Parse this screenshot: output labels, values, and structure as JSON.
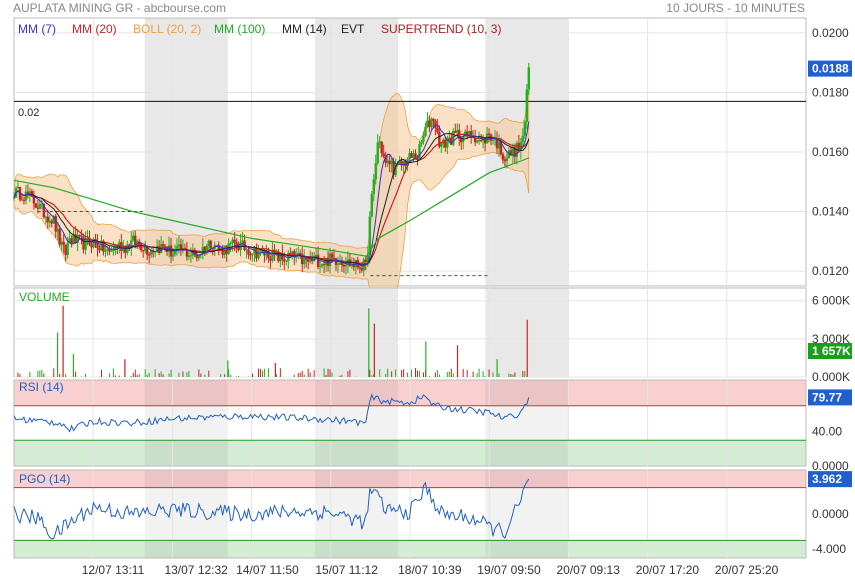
{
  "header": {
    "title": "AUPLATA MINING GR - abcbourse.com",
    "period": "10 JOURS - 10 MINUTES"
  },
  "colors": {
    "price_up": "#22b022",
    "price_down": "#cc2222",
    "mm7": "#3333cc",
    "mm20": "#cc2222",
    "boll": "#f0a040",
    "mm100": "#22aa22",
    "mm14": "#222222",
    "supertrend": "#aa2222",
    "last_badge": "#1f5fd0",
    "volume_badge": "#18a018",
    "rsi_line": "#2060c0",
    "pgo_line": "#2060c0",
    "overbought_zone": "#f8d0d0",
    "oversold_zone": "#d4ebd4",
    "session_shade": "#e8e8e8"
  },
  "chart_data": [
    {
      "type": "candlestick",
      "panel": "price",
      "legend": [
        {
          "label": "MM (7)",
          "color": "#3333cc"
        },
        {
          "label": "MM (20)",
          "color": "#cc2222"
        },
        {
          "label": "BOLL (20, 2)",
          "color": "#f0a040"
        },
        {
          "label": "MM (100)",
          "color": "#22aa22"
        },
        {
          "label": "MM (14)",
          "color": "#222222"
        },
        {
          "label": "EVT",
          "color": "#222222"
        },
        {
          "label": "SUPERTREND (10, 3)",
          "color": "#aa2222"
        }
      ],
      "yticks": [
        "0.0200",
        "0.0180",
        "0.0160",
        "0.0140",
        "0.0120"
      ],
      "ylim": [
        0.0115,
        0.0205
      ],
      "reference_line": {
        "label": "0.02",
        "value": 0.0177
      },
      "last_value": "0.0188",
      "xticks": [
        "12/07 13:11",
        "13/07 12:32",
        "14/07 11:50",
        "15/07 11:12",
        "18/07 10:39",
        "19/07 09:50",
        "20/07 09:13",
        "20/07 17:20",
        "20/07 25:20"
      ],
      "sessions": [
        "12/07",
        "13/07",
        "14/07",
        "15/07",
        "18/07",
        "19/07",
        "20/07"
      ],
      "close_path": [
        [
          0,
          0.01465
        ],
        [
          0.01,
          0.0146
        ],
        [
          0.02,
          0.0145
        ],
        [
          0.03,
          0.0142
        ],
        [
          0.04,
          0.0139
        ],
        [
          0.05,
          0.0137
        ],
        [
          0.06,
          0.0128
        ],
        [
          0.065,
          0.0126
        ],
        [
          0.07,
          0.0131
        ],
        [
          0.08,
          0.013
        ],
        [
          0.09,
          0.0129
        ],
        [
          0.1,
          0.013
        ],
        [
          0.11,
          0.0128
        ],
        [
          0.12,
          0.0126
        ],
        [
          0.13,
          0.0129
        ],
        [
          0.14,
          0.0128
        ],
        [
          0.15,
          0.013
        ],
        [
          0.16,
          0.0129
        ],
        [
          0.17,
          0.0127
        ],
        [
          0.18,
          0.0128
        ],
        [
          0.19,
          0.0128
        ],
        [
          0.2,
          0.0126
        ],
        [
          0.21,
          0.0127
        ],
        [
          0.22,
          0.0126
        ],
        [
          0.23,
          0.0125
        ],
        [
          0.24,
          0.0128
        ],
        [
          0.25,
          0.013
        ],
        [
          0.26,
          0.0127
        ],
        [
          0.27,
          0.0128
        ],
        [
          0.28,
          0.0129
        ],
        [
          0.29,
          0.0128
        ],
        [
          0.3,
          0.0127
        ],
        [
          0.31,
          0.0126
        ],
        [
          0.32,
          0.0126
        ],
        [
          0.33,
          0.0125
        ],
        [
          0.34,
          0.0124
        ],
        [
          0.35,
          0.0125
        ],
        [
          0.36,
          0.0124
        ],
        [
          0.37,
          0.0123
        ],
        [
          0.38,
          0.0124
        ],
        [
          0.39,
          0.0123
        ],
        [
          0.4,
          0.0124
        ],
        [
          0.41,
          0.0124
        ],
        [
          0.42,
          0.0123
        ],
        [
          0.43,
          0.0122
        ],
        [
          0.44,
          0.0122
        ],
        [
          0.445,
          0.0121
        ],
        [
          0.45,
          0.014
        ],
        [
          0.455,
          0.0152
        ],
        [
          0.46,
          0.0165
        ],
        [
          0.465,
          0.016
        ],
        [
          0.47,
          0.0155
        ],
        [
          0.475,
          0.0157
        ],
        [
          0.48,
          0.0154
        ],
        [
          0.49,
          0.0156
        ],
        [
          0.5,
          0.0158
        ],
        [
          0.51,
          0.0159
        ],
        [
          0.52,
          0.0168
        ],
        [
          0.53,
          0.0172
        ],
        [
          0.535,
          0.0165
        ],
        [
          0.54,
          0.0162
        ],
        [
          0.55,
          0.0164
        ],
        [
          0.56,
          0.0166
        ],
        [
          0.57,
          0.0165
        ],
        [
          0.58,
          0.0166
        ],
        [
          0.59,
          0.0163
        ],
        [
          0.6,
          0.0166
        ],
        [
          0.61,
          0.0163
        ],
        [
          0.62,
          0.0158
        ],
        [
          0.63,
          0.016
        ],
        [
          0.64,
          0.0162
        ],
        [
          0.645,
          0.017
        ],
        [
          0.65,
          0.0188
        ]
      ],
      "ema100_path": [
        [
          0,
          0.01505
        ],
        [
          0.05,
          0.0148
        ],
        [
          0.1,
          0.0144
        ],
        [
          0.15,
          0.014
        ],
        [
          0.2,
          0.0137
        ],
        [
          0.25,
          0.0134
        ],
        [
          0.3,
          0.0131
        ],
        [
          0.35,
          0.0129
        ],
        [
          0.4,
          0.0127
        ],
        [
          0.445,
          0.0125
        ],
        [
          0.46,
          0.0131
        ],
        [
          0.5,
          0.0137
        ],
        [
          0.55,
          0.0145
        ],
        [
          0.6,
          0.0153
        ],
        [
          0.65,
          0.0158
        ]
      ]
    },
    {
      "type": "bar",
      "panel": "volume",
      "title": "VOLUME",
      "yticks": [
        "6 000K",
        "3 000K",
        "0.000K"
      ],
      "ylim": [
        0,
        7000
      ],
      "last_value": "1 657K",
      "spikes": [
        {
          "x": 0.055,
          "value": 3500
        },
        {
          "x": 0.062,
          "value": 5600
        },
        {
          "x": 0.075,
          "value": 1800
        },
        {
          "x": 0.14,
          "value": 1400
        },
        {
          "x": 0.27,
          "value": 1300
        },
        {
          "x": 0.33,
          "value": 1100
        },
        {
          "x": 0.448,
          "value": 5400
        },
        {
          "x": 0.455,
          "value": 4200
        },
        {
          "x": 0.52,
          "value": 2800
        },
        {
          "x": 0.56,
          "value": 2500
        },
        {
          "x": 0.61,
          "value": 1400
        },
        {
          "x": 0.648,
          "value": 4500
        }
      ]
    },
    {
      "type": "line",
      "panel": "rsi",
      "title": "RSI (14)",
      "yticks": [
        "40.00",
        "0.0000"
      ],
      "ylim": [
        0,
        100
      ],
      "upper_band": 70,
      "lower_band": 30,
      "last_value": "79.77"
    },
    {
      "type": "line",
      "panel": "pgo",
      "title": "PGO (14)",
      "yticks": [
        "0.0000",
        "-4.000"
      ],
      "ylim": [
        -5,
        5
      ],
      "upper_band": 3,
      "lower_band": -3,
      "last_value": "3.962"
    }
  ]
}
